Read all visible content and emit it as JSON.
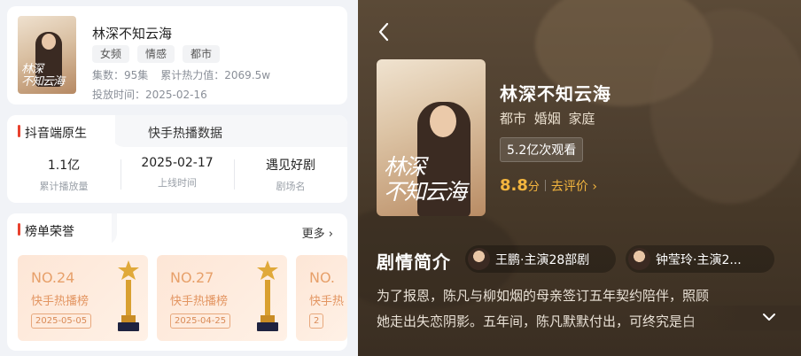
{
  "left": {
    "drama_card": {
      "title": "林深不知云海",
      "tags": [
        "女频",
        "情感",
        "都市"
      ],
      "episodes": "集数：95集",
      "heat": "累计热力值：2069.5w",
      "release": "投放时间：2025-02-16",
      "poster_text": "林深不知云海"
    },
    "data_card": {
      "tab_active": "抖音端原生",
      "tab_other": "快手热播数据",
      "stats": [
        {
          "value": "1.1亿",
          "label": "累计播放量"
        },
        {
          "value": "2025-02-17",
          "label": "上线时间"
        },
        {
          "value": "遇见好剧",
          "label": "剧场名"
        }
      ]
    },
    "honor_card": {
      "title": "榜单荣誉",
      "more": "更多",
      "awards": [
        {
          "rank": "NO.24",
          "name": "快手热播榜",
          "date": "2025-05-05"
        },
        {
          "rank": "NO.27",
          "name": "快手热播榜",
          "date": "2025-04-25"
        },
        {
          "rank": "NO.",
          "name": "快手热",
          "date": "2"
        }
      ]
    }
  },
  "right": {
    "title": "林深不知云海",
    "genres": "都市 婚姻 家庭",
    "views": "5.2亿次观看",
    "score": "8.8",
    "score_unit": "分",
    "rate_link": "去评价",
    "synopsis_title": "剧情简介",
    "cast": [
      {
        "name": "王鹏·主演28部剧"
      },
      {
        "name": "钟莹玲·主演2..."
      }
    ],
    "synopsis_line1": "为了报恩，陈凡与柳如烟的母亲签订五年契约陪伴，照顾",
    "synopsis_line2": "她走出失恋阴影。五年间，陈凡默默付出，可终究是白",
    "poster_text": "林深不知云海"
  },
  "colors": {
    "accent_red": "#e8412e",
    "score_gold": "#f3b53e",
    "award_text": "#e39561"
  }
}
